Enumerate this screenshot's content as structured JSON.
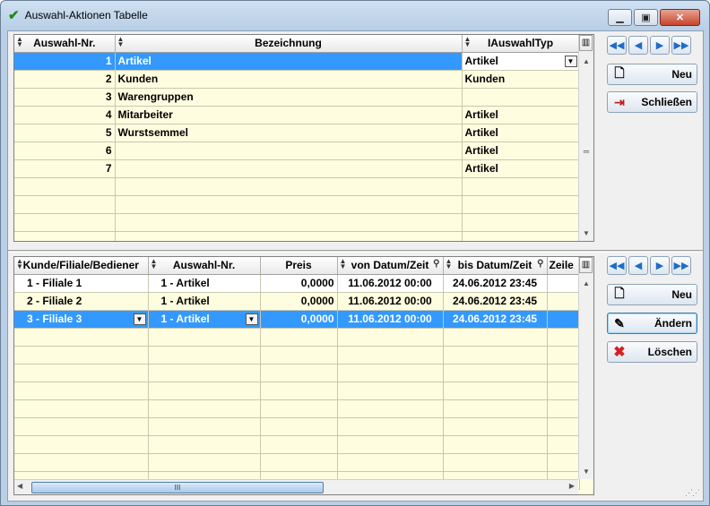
{
  "window": {
    "title": "Auswahl-Aktionen Tabelle",
    "icon": "checkmark-icon"
  },
  "top_grid": {
    "columns": [
      "Auswahl-Nr.",
      "Bezeichnung",
      "IAuswahlTyp"
    ],
    "rows": [
      {
        "nr": "1",
        "bez": "Artikel",
        "typ": "Artikel"
      },
      {
        "nr": "2",
        "bez": "Kunden",
        "typ": "Kunden"
      },
      {
        "nr": "3",
        "bez": "Warengruppen",
        "typ": ""
      },
      {
        "nr": "4",
        "bez": "Mitarbeiter",
        "typ": "Artikel"
      },
      {
        "nr": "5",
        "bez": "Wurstsemmel",
        "typ": "Artikel"
      },
      {
        "nr": "6",
        "bez": "",
        "typ": "Artikel"
      },
      {
        "nr": "7",
        "bez": "",
        "typ": "Artikel"
      }
    ],
    "selected_row": 1
  },
  "top_buttons": {
    "neu": "Neu",
    "schliessen": "Schließen"
  },
  "bottom_grid": {
    "columns": [
      "Kunde/Filiale/Bediener",
      "Auswahl-Nr.",
      "Preis",
      "von Datum/Zeit",
      "bis Datum/Zeit",
      "Zeile"
    ],
    "rows": [
      {
        "kunde": "1 - Filiale 1",
        "nr": "1 - Artikel",
        "preis": "0,0000",
        "von": "11.06.2012 00:00",
        "bis": "24.06.2012 23:45"
      },
      {
        "kunde": "2 - Filiale 2",
        "nr": "1 - Artikel",
        "preis": "0,0000",
        "von": "11.06.2012 00:00",
        "bis": "24.06.2012 23:45"
      },
      {
        "kunde": "3 - Filiale 3",
        "nr": "1 - Artikel",
        "preis": "0,0000",
        "von": "11.06.2012 00:00",
        "bis": "24.06.2012 23:45"
      }
    ],
    "selected_row": 3,
    "scroll_thumb": "III"
  },
  "bottom_buttons": {
    "neu": "Neu",
    "aendern": "Ändern",
    "loeschen": "Löschen"
  },
  "colors": {
    "selection": "#3399ff",
    "grid_bg": "#fffde0",
    "nav_arrow": "#1e6cc8",
    "delete_icon": "#d42020"
  }
}
